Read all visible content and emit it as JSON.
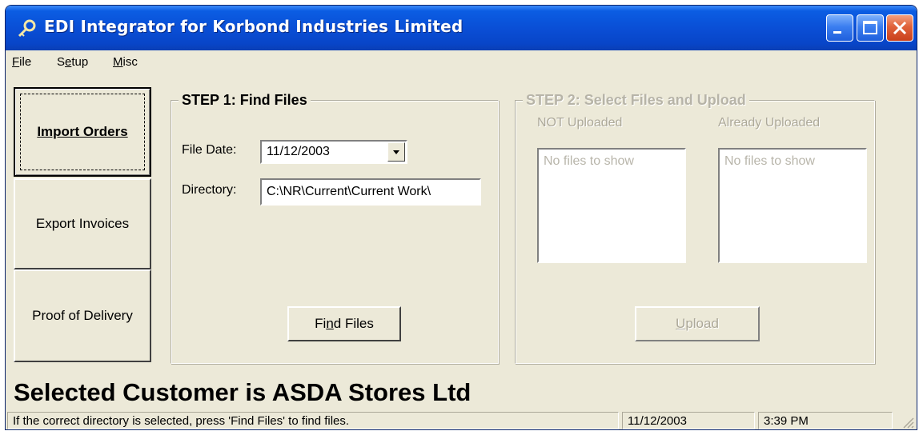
{
  "window": {
    "title": "EDI Integrator for Korbond Industries Limited"
  },
  "menu": [
    {
      "label": "File",
      "mnemonic": "F",
      "rest": "ile"
    },
    {
      "label": "Setup",
      "pre": "S",
      "mnemonic": "e",
      "rest": "tup"
    },
    {
      "label": "Misc",
      "mnemonic": "M",
      "rest": "isc"
    }
  ],
  "sidebar": {
    "items": [
      {
        "label": "Import Orders",
        "active": true
      },
      {
        "label": "Export Invoices",
        "active": false
      },
      {
        "label": "Proof of Delivery",
        "active": false
      }
    ]
  },
  "step1": {
    "title": "STEP 1: Find Files",
    "file_date_label": "File Date:",
    "file_date_value": "11/12/2003",
    "directory_label": "Directory:",
    "directory_value": "C:\\NR\\Current\\Current Work\\",
    "find_button": {
      "label": "Find Files",
      "pre": "Fi",
      "mnemonic": "n",
      "rest": "d Files"
    }
  },
  "step2": {
    "title": "STEP 2: Select Files and Upload",
    "not_uploaded_label": "NOT Uploaded",
    "already_uploaded_label": "Already Uploaded",
    "not_uploaded_empty": "No files to show",
    "already_uploaded_empty": "No files to show",
    "upload_button": {
      "label": "Upload",
      "mnemonic": "U",
      "rest": "pload"
    }
  },
  "customer_banner": "Selected Customer is ASDA Stores Ltd",
  "status": {
    "message": "If the correct directory is selected, press 'Find Files' to find files.",
    "date": "11/12/2003",
    "time": "3:39 PM"
  },
  "colors": {
    "titlebar": "#0a4fd6",
    "window_face": "#ece9d8",
    "close_button": "#e0623a"
  },
  "icons": [
    "app-key-icon",
    "minimize-icon",
    "maximize-icon",
    "close-icon",
    "dropdown-arrow-icon",
    "size-grip-icon"
  ]
}
